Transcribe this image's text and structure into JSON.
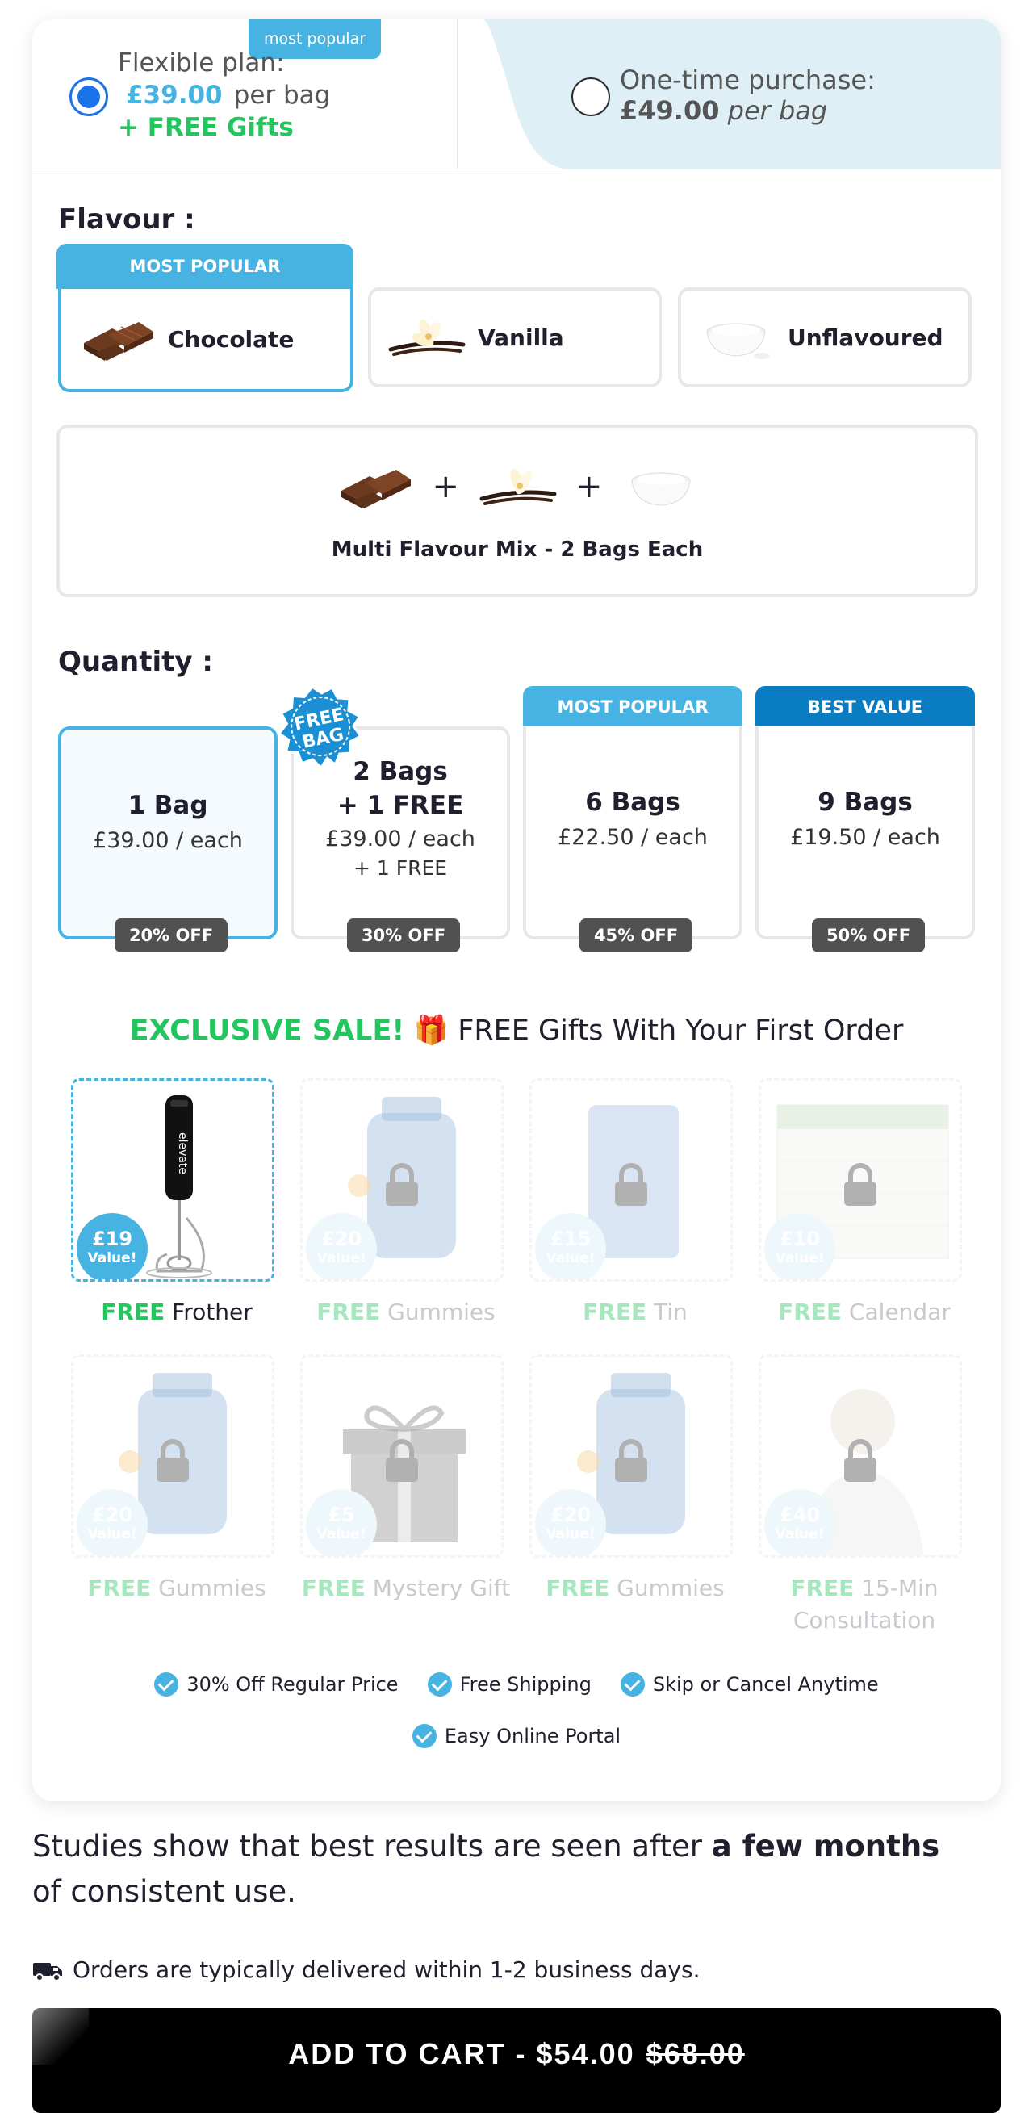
{
  "plans": {
    "badge": "most popular",
    "flexible": {
      "label": "Flexible plan:",
      "price": "£39.00",
      "per": "per bag",
      "gifts": "+ FREE Gifts"
    },
    "onetime": {
      "label": "One-time purchase:",
      "price": "£49.00",
      "per": "per bag"
    }
  },
  "flavour": {
    "heading": "Flavour :",
    "tab": "MOST POPULAR",
    "options": [
      {
        "label": "Chocolate",
        "icon": "chocolate-icon"
      },
      {
        "label": "Vanilla",
        "icon": "vanilla-icon"
      },
      {
        "label": "Unflavoured",
        "icon": "powder-bowl-icon"
      }
    ],
    "multi": "Multi Flavour Mix - 2 Bags Each",
    "plus": "+"
  },
  "quantity": {
    "heading": "Quantity :",
    "free_bag_badge": [
      "FREE",
      "BAG"
    ],
    "options": [
      {
        "title": "1 Bag",
        "price": "£39.00 / each",
        "extra": "",
        "off": "20% OFF",
        "tab": ""
      },
      {
        "title": "2 Bags",
        "title2": "+ 1 FREE",
        "price": "£39.00 / each",
        "extra": "+ 1 FREE",
        "off": "30% OFF",
        "tab": ""
      },
      {
        "title": "6 Bags",
        "price": "£22.50 / each",
        "extra": "",
        "off": "45% OFF",
        "tab": "MOST POPULAR"
      },
      {
        "title": "9 Bags",
        "price": "£19.50 / each",
        "extra": "",
        "off": "50% OFF",
        "tab": "BEST VALUE"
      }
    ]
  },
  "gifts": {
    "sale": "EXCLUSIVE SALE!",
    "heading": "FREE Gifts With Your First Order",
    "free_word": "FREE",
    "items": [
      {
        "name": "Frother",
        "value": "£19",
        "value_word": "Value!"
      },
      {
        "name": "Gummies",
        "value": "£20",
        "value_word": "Value!"
      },
      {
        "name": "Tin",
        "value": "£15",
        "value_word": "Value!"
      },
      {
        "name": "Calendar",
        "value": "£10",
        "value_word": "Value!"
      },
      {
        "name": "Gummies",
        "value": "£20",
        "value_word": "Value!"
      },
      {
        "name": "Mystery Gift",
        "value": "£5",
        "value_word": "Value!"
      },
      {
        "name": "Gummies",
        "value": "£20",
        "value_word": "Value!"
      },
      {
        "name": "15-Min",
        "name2": "Consultation",
        "value": "£40",
        "value_word": "Value!"
      }
    ],
    "brand_text": "elevate"
  },
  "perks": [
    "30% Off Regular Price",
    "Free Shipping",
    "Skip or Cancel Anytime",
    "Easy Online Portal"
  ],
  "studies": {
    "before": "Studies show that best results are seen after ",
    "bold": "a few months",
    "after": " of consistent use."
  },
  "delivery": "Orders are typically delivered within 1-2 business days.",
  "cta": {
    "label": "ADD TO CART - $54.00",
    "old": "$68.00"
  },
  "colors": {
    "accent": "#47b3e2",
    "best_value": "#0a7dc2",
    "green": "#22c55e",
    "dark": "#1f1f2e"
  }
}
